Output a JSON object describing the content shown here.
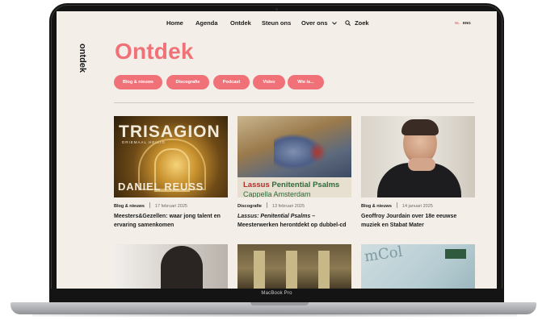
{
  "device": {
    "label": "MacBook Pro"
  },
  "nav": {
    "items": [
      "Home",
      "Agenda",
      "Ontdek",
      "Steun ons",
      "Over ons"
    ],
    "search_label": "Zoek",
    "languages": [
      "NL",
      "ENG"
    ]
  },
  "sidebar": {
    "vertical_label": "ontdek"
  },
  "page": {
    "title": "Ontdek"
  },
  "filters": [
    "Blog & nieuws",
    "Discografie",
    "Podcast",
    "Video",
    "Wie is..."
  ],
  "cards": [
    {
      "category": "Blog & nieuws",
      "date": "17 februari 2025",
      "title": "Meesters&Gezellen: waar jong talent en ervaring samenkomen",
      "image_text": {
        "title": "TRISAGION",
        "subtitle": "DRIEMAAL HEILIG",
        "artist": "DANIEL REUSS"
      }
    },
    {
      "category": "Discografie",
      "date": "13 februari 2025",
      "title_italic": "Lassus: Penitential Psalms",
      "title_rest": " – Meesterwerken herontdekt op dubbel-cd",
      "image_text": {
        "line1_a": "Lassus ",
        "line1_b": "Penitential Psalms",
        "line2": "Cappella Amsterdam"
      }
    },
    {
      "category": "Blog & nieuws",
      "date": "14 januari 2025",
      "title": "Geoffroy Jourdain over 18e eeuwse muziek en Stabat Mater"
    }
  ],
  "colors": {
    "accent": "#f07177",
    "background": "#f3efe8",
    "text": "#1b1b1b"
  }
}
